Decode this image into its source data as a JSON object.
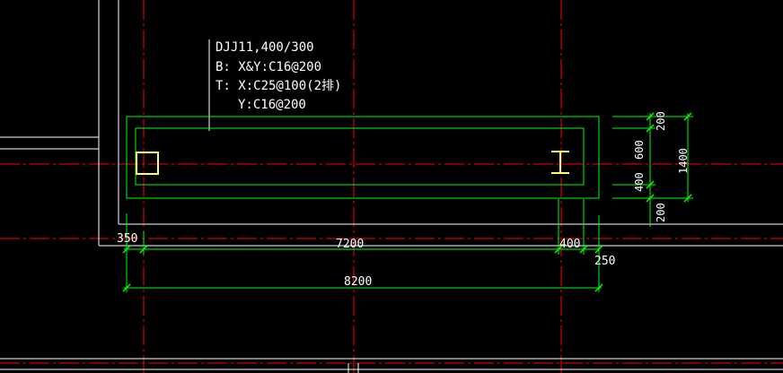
{
  "drawing": {
    "background": "#000000",
    "colors": {
      "wall": "#ffffff",
      "axis": "#ff0000",
      "foundation": "#00ff00",
      "column": "#ffff66",
      "text": "#ffffff"
    },
    "label": {
      "line1": "DJJ11,400/300",
      "line2": "B: X&Y:C16@200",
      "line3": "T: X:C25@100(2排)",
      "line4": "Y:C16@200"
    },
    "dimensions": {
      "horizontal": {
        "d350": "350",
        "d7200": "7200",
        "d400": "400",
        "d250": "250",
        "d8200": "8200"
      },
      "vertical": {
        "v200_top": "200",
        "v600": "600",
        "v400": "400",
        "v200_bottom": "200",
        "v1400": "1400"
      }
    }
  }
}
